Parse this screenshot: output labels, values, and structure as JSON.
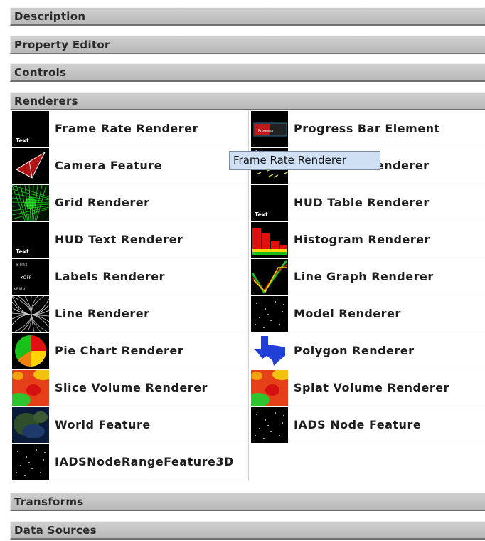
{
  "sections": {
    "description": "Description",
    "property_editor": "Property Editor",
    "controls": "Controls",
    "renderers": "Renderers",
    "transforms": "Transforms",
    "data_sources": "Data Sources"
  },
  "renderers": {
    "items": [
      {
        "label": "Frame Rate Renderer",
        "icon": "text-thumbnail"
      },
      {
        "label": "Progress Bar Element",
        "icon": "progress-bar-thumbnail"
      },
      {
        "label": "Camera Feature",
        "icon": "camera-thumbnail"
      },
      {
        "label": "Flow Field Renderer",
        "icon": "flow-field-thumbnail"
      },
      {
        "label": "Grid Renderer",
        "icon": "grid-thumbnail"
      },
      {
        "label": "HUD Table Renderer",
        "icon": "text-thumbnail"
      },
      {
        "label": "HUD Text Renderer",
        "icon": "text-thumbnail"
      },
      {
        "label": "Histogram Renderer",
        "icon": "histogram-thumbnail"
      },
      {
        "label": "Labels Renderer",
        "icon": "labels-thumbnail"
      },
      {
        "label": "Line Graph Renderer",
        "icon": "line-graph-thumbnail"
      },
      {
        "label": "Line Renderer",
        "icon": "lines-thumbnail"
      },
      {
        "label": "Model Renderer",
        "icon": "points-thumbnail"
      },
      {
        "label": "Pie Chart Renderer",
        "icon": "pie-chart-thumbnail"
      },
      {
        "label": "Polygon Renderer",
        "icon": "texas-map-thumbnail"
      },
      {
        "label": "Slice Volume Renderer",
        "icon": "heatmap-thumbnail"
      },
      {
        "label": "Splat Volume Renderer",
        "icon": "heatmap-thumbnail"
      },
      {
        "label": "World Feature",
        "icon": "globe-thumbnail"
      },
      {
        "label": "IADS Node Feature",
        "icon": "points-thumbnail"
      },
      {
        "label": "IADSNodeRangeFeature3D",
        "icon": "points-thumbnail"
      }
    ],
    "thumb_text": "Text",
    "progress_thumb_text": "Progress",
    "labels_thumb": [
      "KTDX",
      "KOFF",
      "KFMV"
    ]
  },
  "tooltip": "Frame Rate Renderer"
}
